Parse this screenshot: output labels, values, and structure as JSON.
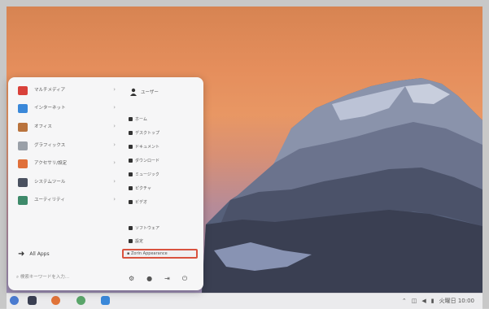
{
  "menu": {
    "categories": [
      {
        "label": "マルチメディア",
        "icon": "multimedia-icon",
        "color": "#d9413a"
      },
      {
        "label": "インターネット",
        "icon": "internet-icon",
        "color": "#3a88d9"
      },
      {
        "label": "オフィス",
        "icon": "office-icon",
        "color": "#b9733d"
      },
      {
        "label": "グラフィックス",
        "icon": "graphics-icon",
        "color": "#9aa0a8"
      },
      {
        "label": "アクセサリ/設定",
        "icon": "accessories-icon",
        "color": "#e0703a"
      },
      {
        "label": "システムツール",
        "icon": "system-tools-icon",
        "color": "#4a5160"
      },
      {
        "label": "ユーティリティ",
        "icon": "utilities-icon",
        "color": "#3e8a6a"
      }
    ],
    "user": "ユーザー",
    "places": [
      "ホーム",
      "デスクトップ",
      "ドキュメント",
      "ダウンロード",
      "ミュージック",
      "ピクチャ",
      "ビデオ"
    ],
    "settings_items": [
      "ソフトウェア",
      "設定"
    ],
    "highlighted": "Zorin Appearance",
    "all_apps": "All Apps",
    "search_placeholder": "検索キーワードを入力..."
  },
  "taskbar": {
    "tray_time": "火曜日 10:00"
  }
}
